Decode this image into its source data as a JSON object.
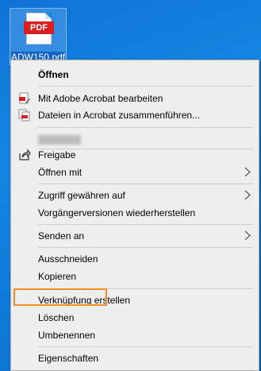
{
  "desktop": {
    "file_label": "ADW150.pdf",
    "icon_text": "PDF"
  },
  "menu": {
    "open": "Öffnen",
    "edit_acrobat": "Mit Adobe Acrobat bearbeiten",
    "combine_acrobat": "Dateien in Acrobat zusammenführen...",
    "share": "Freigabe",
    "open_with": "Öffnen mit",
    "give_access": "Zugriff gewähren auf",
    "restore_versions": "Vorgängerversionen wiederherstellen",
    "send_to": "Senden an",
    "cut": "Ausschneiden",
    "copy": "Kopieren",
    "create_shortcut": "Verknüpfung erstellen",
    "delete": "Löschen",
    "rename": "Umbenennen",
    "properties": "Eigenschaften"
  },
  "colors": {
    "highlight": "#f28c28",
    "pdf_red": "#d81e1e"
  }
}
